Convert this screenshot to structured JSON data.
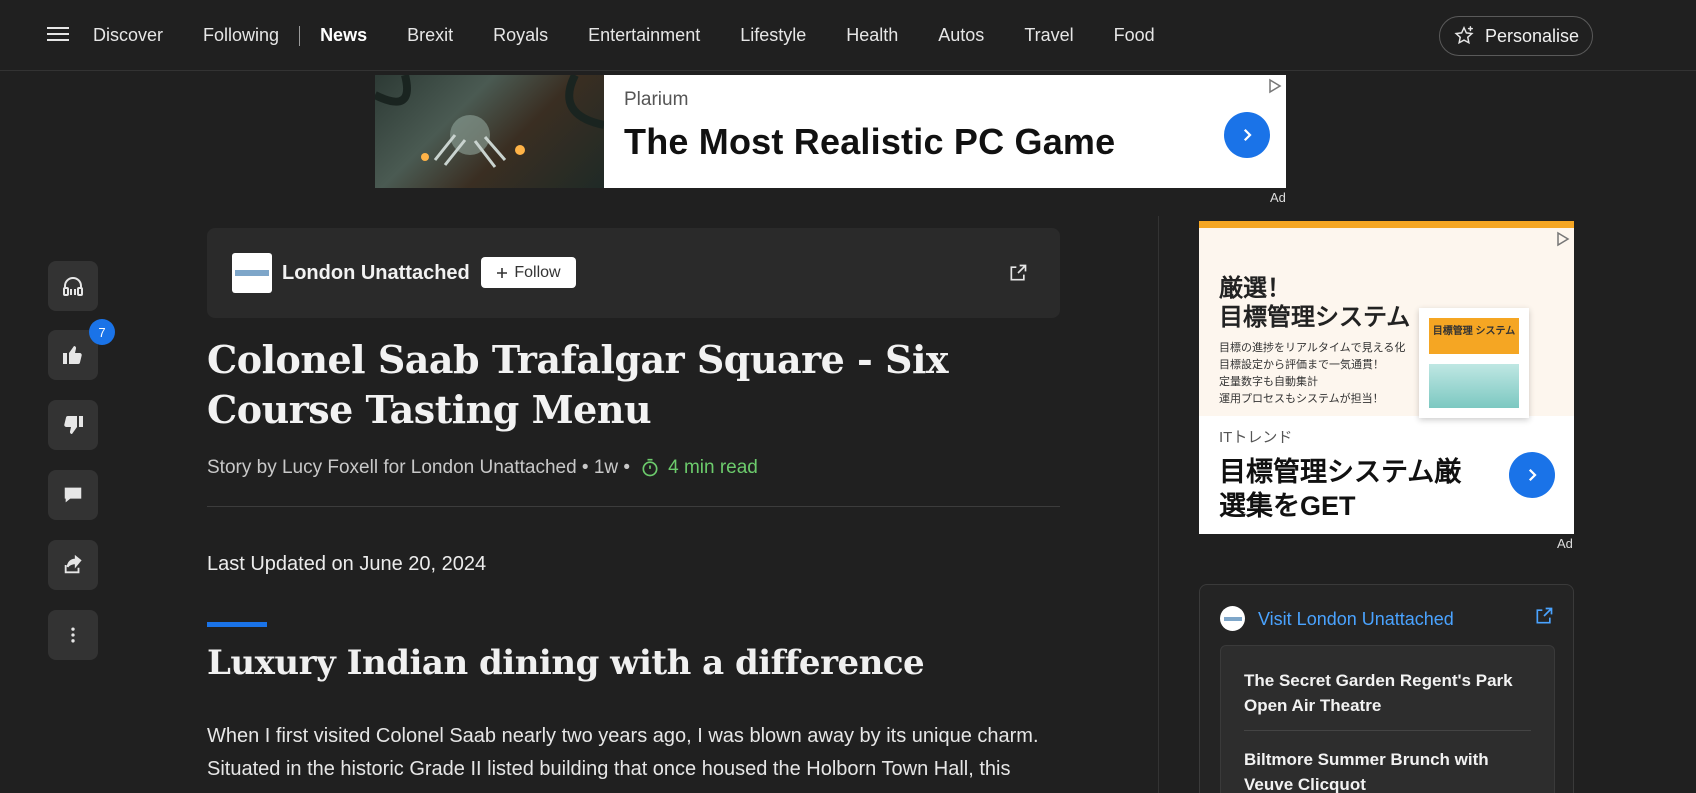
{
  "nav": {
    "items": [
      "Discover",
      "Following"
    ],
    "items2": [
      "News",
      "Brexit",
      "Royals",
      "Entertainment",
      "Lifestyle",
      "Health",
      "Autos",
      "Travel",
      "Food"
    ],
    "personalise_label": "Personalise"
  },
  "top_ad": {
    "brand": "Plarium",
    "title": "The Most Realistic PC Game",
    "ad_label": "Ad"
  },
  "rail": {
    "like_count": "7"
  },
  "article": {
    "publisher": "London Unattached",
    "follow_label": "Follow",
    "headline": "Colonel Saab Trafalgar Square - Six Course Tasting Menu",
    "byline": "Story by Lucy Foxell for London Unattached • 1w •",
    "read_time": "4 min read",
    "updated": "Last Updated on June 20, 2024",
    "subhead": "Luxury Indian dining with a difference",
    "body": "When I first visited Colonel Saab nearly two years ago, I was blown away by its unique charm. Situated in the historic Grade II listed building that once housed the Holborn Town Hall, this restaurant exudes a sense of grandeur and history."
  },
  "side_ad": {
    "headline_line1": "厳選！",
    "headline_line2": "目標管理システム",
    "bullets": [
      "目標の進捗をリアルタイムで見える化",
      "目標設定から評価まで一気通貫！",
      "定量数字も自動集計",
      "運用プロセスもシステムが担当！"
    ],
    "card_title": "目標管理\nシステム",
    "brand": "ITトレンド",
    "title": "目標管理システム厳選集をGET",
    "ad_label": "Ad"
  },
  "more_from": {
    "link_label": "Visit London Unattached",
    "items": [
      "The Secret Garden Regent's Park Open Air Theatre",
      "Biltmore Summer Brunch with Veuve Clicquot"
    ]
  },
  "colors": {
    "background": "#202020",
    "accent": "#1a73e8",
    "read_time": "#6ccb6c",
    "link": "#4aa3ff"
  }
}
